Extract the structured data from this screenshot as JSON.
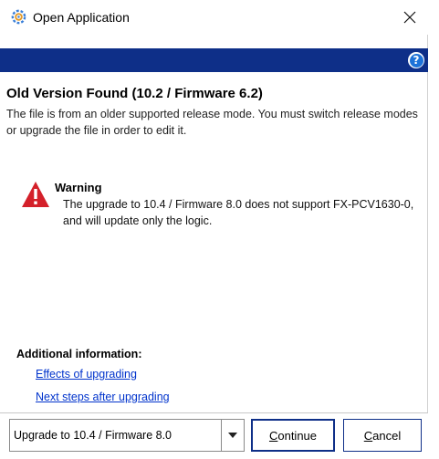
{
  "window": {
    "title": "Open Application",
    "icon": "app-gear-icon",
    "close_icon": "close-icon"
  },
  "header_bar": {
    "color": "#0e2f88",
    "help_icon": "help-icon",
    "help_glyph": "?"
  },
  "content": {
    "heading": "Old Version Found (10.2 / Firmware 6.2)",
    "description": "The file is from an older supported release mode. You must switch release modes or upgrade the file in order to edit it.",
    "warning": {
      "icon": "warning-triangle-icon",
      "icon_color": "#d4202a",
      "title": "Warning",
      "text": "The upgrade to 10.4 / Firmware 8.0 does not support FX-PCV1630-0, and will update only the logic."
    },
    "additional_info": {
      "title": "Additional information:",
      "links": [
        {
          "label": "Effects of upgrading"
        },
        {
          "label": "Next steps after upgrading"
        }
      ]
    }
  },
  "footer": {
    "selector_value": "Upgrade to 10.4 / Firmware 8.0",
    "selector_arrow_icon": "caret-down-icon",
    "continue_label": "Continue",
    "cancel_label": "Cancel"
  },
  "colors": {
    "accent": "#0e2f88",
    "link": "#0033cc"
  }
}
